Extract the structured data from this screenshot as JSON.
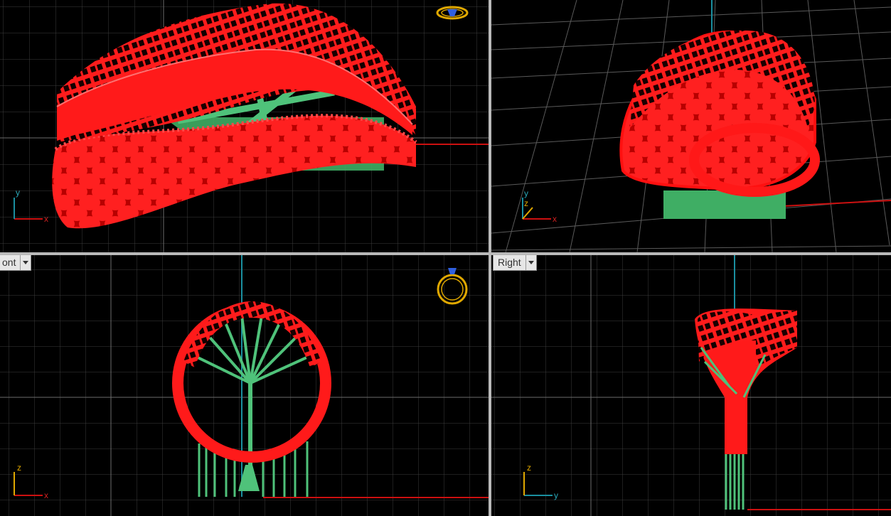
{
  "viewports": {
    "top": {
      "axes": [
        "y",
        "x"
      ]
    },
    "perspective": {
      "axes": [
        "y",
        "z",
        "x"
      ]
    },
    "front": {
      "label": "ont",
      "axes": [
        "z",
        "x"
      ]
    },
    "right": {
      "label": "Right",
      "axes": [
        "z",
        "y"
      ]
    }
  },
  "icons": [
    "ring-top-view-icon",
    "ring-front-view-icon"
  ],
  "colors": {
    "background": "#000000",
    "grid_minor": "#3a3a3a",
    "grid_major": "#6c6c6c",
    "axis_x": "#cc1010",
    "axis_vertical": "#1a8fa0",
    "model_red": "#ff1414",
    "support_green": "#4fc27a",
    "gizmo_gold": "#e0a800",
    "gizmo_blue": "#3060e0"
  }
}
